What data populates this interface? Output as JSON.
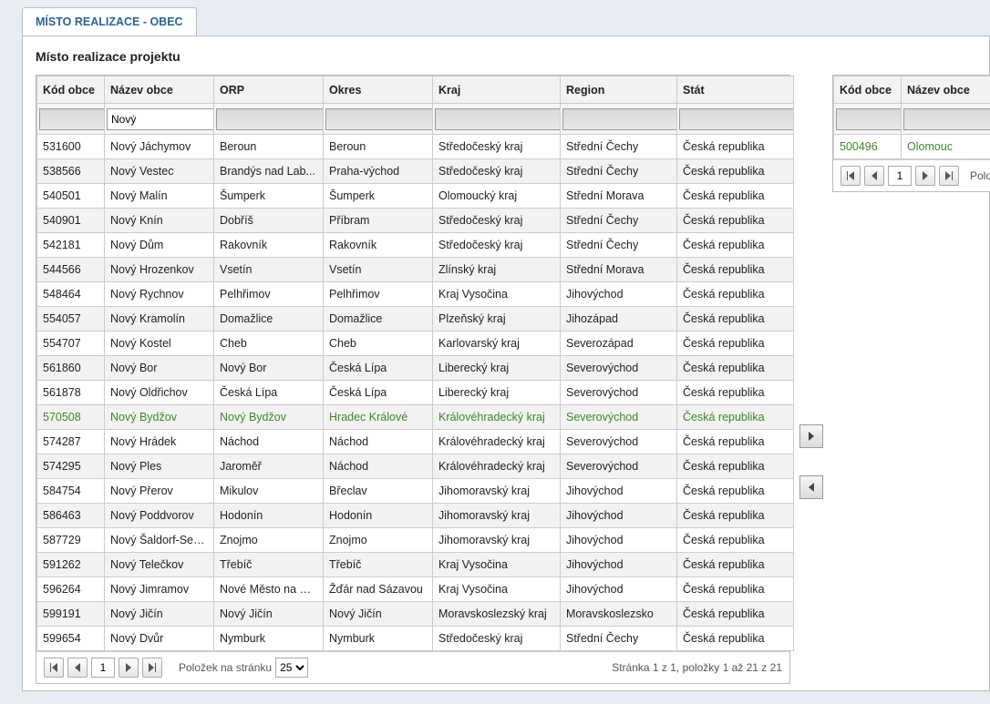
{
  "tab": {
    "label": "MÍSTO REALIZACE - OBEC"
  },
  "heading": "Místo realizace projektu",
  "filter_value": "Nový",
  "left_columns": [
    "Kód obce",
    "Název obce",
    "ORP",
    "Okres",
    "Kraj",
    "Region",
    "Stát"
  ],
  "right_columns": [
    "Kód obce",
    "Název obce"
  ],
  "left_rows": [
    {
      "kod": "531600",
      "nazev": "Nový Jáchymov",
      "orp": "Beroun",
      "okres": "Beroun",
      "kraj": "Středočeský kraj",
      "region": "Střední Čechy",
      "stat": "Česká republika"
    },
    {
      "kod": "538566",
      "nazev": "Nový Vestec",
      "orp": "Brandýs nad Lab...",
      "okres": "Praha-východ",
      "kraj": "Středočeský kraj",
      "region": "Střední Čechy",
      "stat": "Česká republika"
    },
    {
      "kod": "540501",
      "nazev": "Nový Malín",
      "orp": "Šumperk",
      "okres": "Šumperk",
      "kraj": "Olomoucký kraj",
      "region": "Střední Morava",
      "stat": "Česká republika"
    },
    {
      "kod": "540901",
      "nazev": "Nový Knín",
      "orp": "Dobříš",
      "okres": "Příbram",
      "kraj": "Středočeský kraj",
      "region": "Střední Čechy",
      "stat": "Česká republika"
    },
    {
      "kod": "542181",
      "nazev": "Nový Dům",
      "orp": "Rakovník",
      "okres": "Rakovník",
      "kraj": "Středočeský kraj",
      "region": "Střední Čechy",
      "stat": "Česká republika"
    },
    {
      "kod": "544566",
      "nazev": "Nový Hrozenkov",
      "orp": "Vsetín",
      "okres": "Vsetín",
      "kraj": "Zlínský kraj",
      "region": "Střední Morava",
      "stat": "Česká republika"
    },
    {
      "kod": "548464",
      "nazev": "Nový Rychnov",
      "orp": "Pelhřimov",
      "okres": "Pelhřimov",
      "kraj": "Kraj Vysočina",
      "region": "Jihovýchod",
      "stat": "Česká republika"
    },
    {
      "kod": "554057",
      "nazev": "Nový Kramolín",
      "orp": "Domažlice",
      "okres": "Domažlice",
      "kraj": "Plzeňský kraj",
      "region": "Jihozápad",
      "stat": "Česká republika"
    },
    {
      "kod": "554707",
      "nazev": "Nový Kostel",
      "orp": "Cheb",
      "okres": "Cheb",
      "kraj": "Karlovarský kraj",
      "region": "Severozápad",
      "stat": "Česká republika"
    },
    {
      "kod": "561860",
      "nazev": "Nový Bor",
      "orp": "Nový Bor",
      "okres": "Česká Lípa",
      "kraj": "Liberecký kraj",
      "region": "Severovýchod",
      "stat": "Česká republika"
    },
    {
      "kod": "561878",
      "nazev": "Nový Oldřichov",
      "orp": "Česká Lípa",
      "okres": "Česká Lípa",
      "kraj": "Liberecký kraj",
      "region": "Severovýchod",
      "stat": "Česká republika"
    },
    {
      "kod": "570508",
      "nazev": "Nový Bydžov",
      "orp": "Nový Bydžov",
      "okres": "Hradec Králové",
      "kraj": "Královéhradecký kraj",
      "region": "Severovýchod",
      "stat": "Česká republika",
      "hl": true
    },
    {
      "kod": "574287",
      "nazev": "Nový Hrádek",
      "orp": "Náchod",
      "okres": "Náchod",
      "kraj": "Královéhradecký kraj",
      "region": "Severovýchod",
      "stat": "Česká republika"
    },
    {
      "kod": "574295",
      "nazev": "Nový Ples",
      "orp": "Jaroměř",
      "okres": "Náchod",
      "kraj": "Královéhradecký kraj",
      "region": "Severovýchod",
      "stat": "Česká republika"
    },
    {
      "kod": "584754",
      "nazev": "Nový Přerov",
      "orp": "Mikulov",
      "okres": "Břeclav",
      "kraj": "Jihomoravský kraj",
      "region": "Jihovýchod",
      "stat": "Česká republika"
    },
    {
      "kod": "586463",
      "nazev": "Nový Poddvorov",
      "orp": "Hodonín",
      "okres": "Hodonín",
      "kraj": "Jihomoravský kraj",
      "region": "Jihovýchod",
      "stat": "Česká republika"
    },
    {
      "kod": "587729",
      "nazev": "Nový Šaldorf-Sed...",
      "orp": "Znojmo",
      "okres": "Znojmo",
      "kraj": "Jihomoravský kraj",
      "region": "Jihovýchod",
      "stat": "Česká republika"
    },
    {
      "kod": "591262",
      "nazev": "Nový Telečkov",
      "orp": "Třebíč",
      "okres": "Třebíč",
      "kraj": "Kraj Vysočina",
      "region": "Jihovýchod",
      "stat": "Česká republika"
    },
    {
      "kod": "596264",
      "nazev": "Nový Jimramov",
      "orp": "Nové Město na M...",
      "okres": "Žďár nad Sázavou",
      "kraj": "Kraj Vysočina",
      "region": "Jihovýchod",
      "stat": "Česká republika"
    },
    {
      "kod": "599191",
      "nazev": "Nový Jičín",
      "orp": "Nový Jičín",
      "okres": "Nový Jičín",
      "kraj": "Moravskoslezský kraj",
      "region": "Moravskoslezsko",
      "stat": "Česká republika"
    },
    {
      "kod": "599654",
      "nazev": "Nový Dvůr",
      "orp": "Nymburk",
      "okres": "Nymburk",
      "kraj": "Středočeský kraj",
      "region": "Střední Čechy",
      "stat": "Česká republika"
    }
  ],
  "right_rows": [
    {
      "kod": "500496",
      "nazev": "Olomouc"
    }
  ],
  "pager": {
    "page": "1",
    "per_page_label": "Položek na stránku",
    "per_page_value": "25",
    "info": "Stránka 1 z 1, položky 1 až 21 z 21",
    "right_label": "Položek n"
  }
}
